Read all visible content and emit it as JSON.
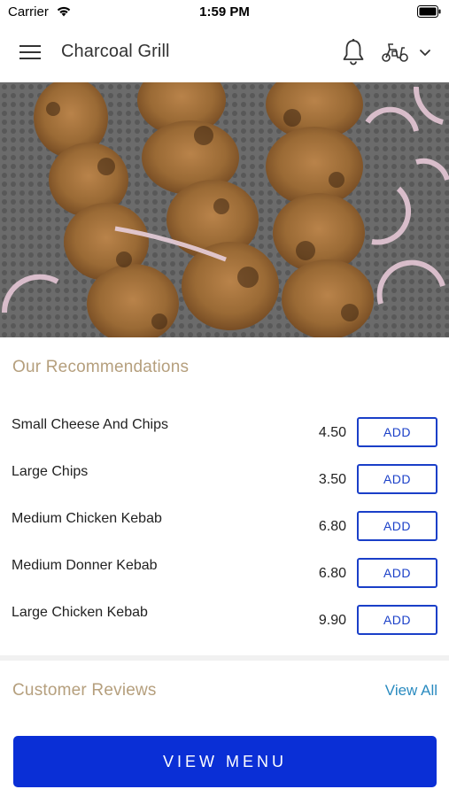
{
  "status_bar": {
    "carrier": "Carrier",
    "time": "1:59 PM"
  },
  "header": {
    "title": "Charcoal Grill",
    "icons": [
      "menu-icon",
      "bell-icon",
      "scooter-icon",
      "chevron-down-icon"
    ]
  },
  "recommendations": {
    "title": "Our Recommendations",
    "add_label": "ADD",
    "items": [
      {
        "name": "Small Cheese And Chips",
        "price": "4.50"
      },
      {
        "name": "Large Chips",
        "price": "3.50"
      },
      {
        "name": "Medium Chicken Kebab",
        "price": "6.80"
      },
      {
        "name": "Medium Donner Kebab",
        "price": "6.80"
      },
      {
        "name": "Large Chicken Kebab",
        "price": "9.90"
      }
    ]
  },
  "reviews": {
    "title": "Customer Reviews",
    "view_all": "View All"
  },
  "footer": {
    "view_menu": "VIEW MENU"
  },
  "colors": {
    "accent": "#0a2fd6",
    "button_border": "#1a3fc8",
    "section_title": "#b59f7d",
    "link": "#2a8bc0"
  }
}
